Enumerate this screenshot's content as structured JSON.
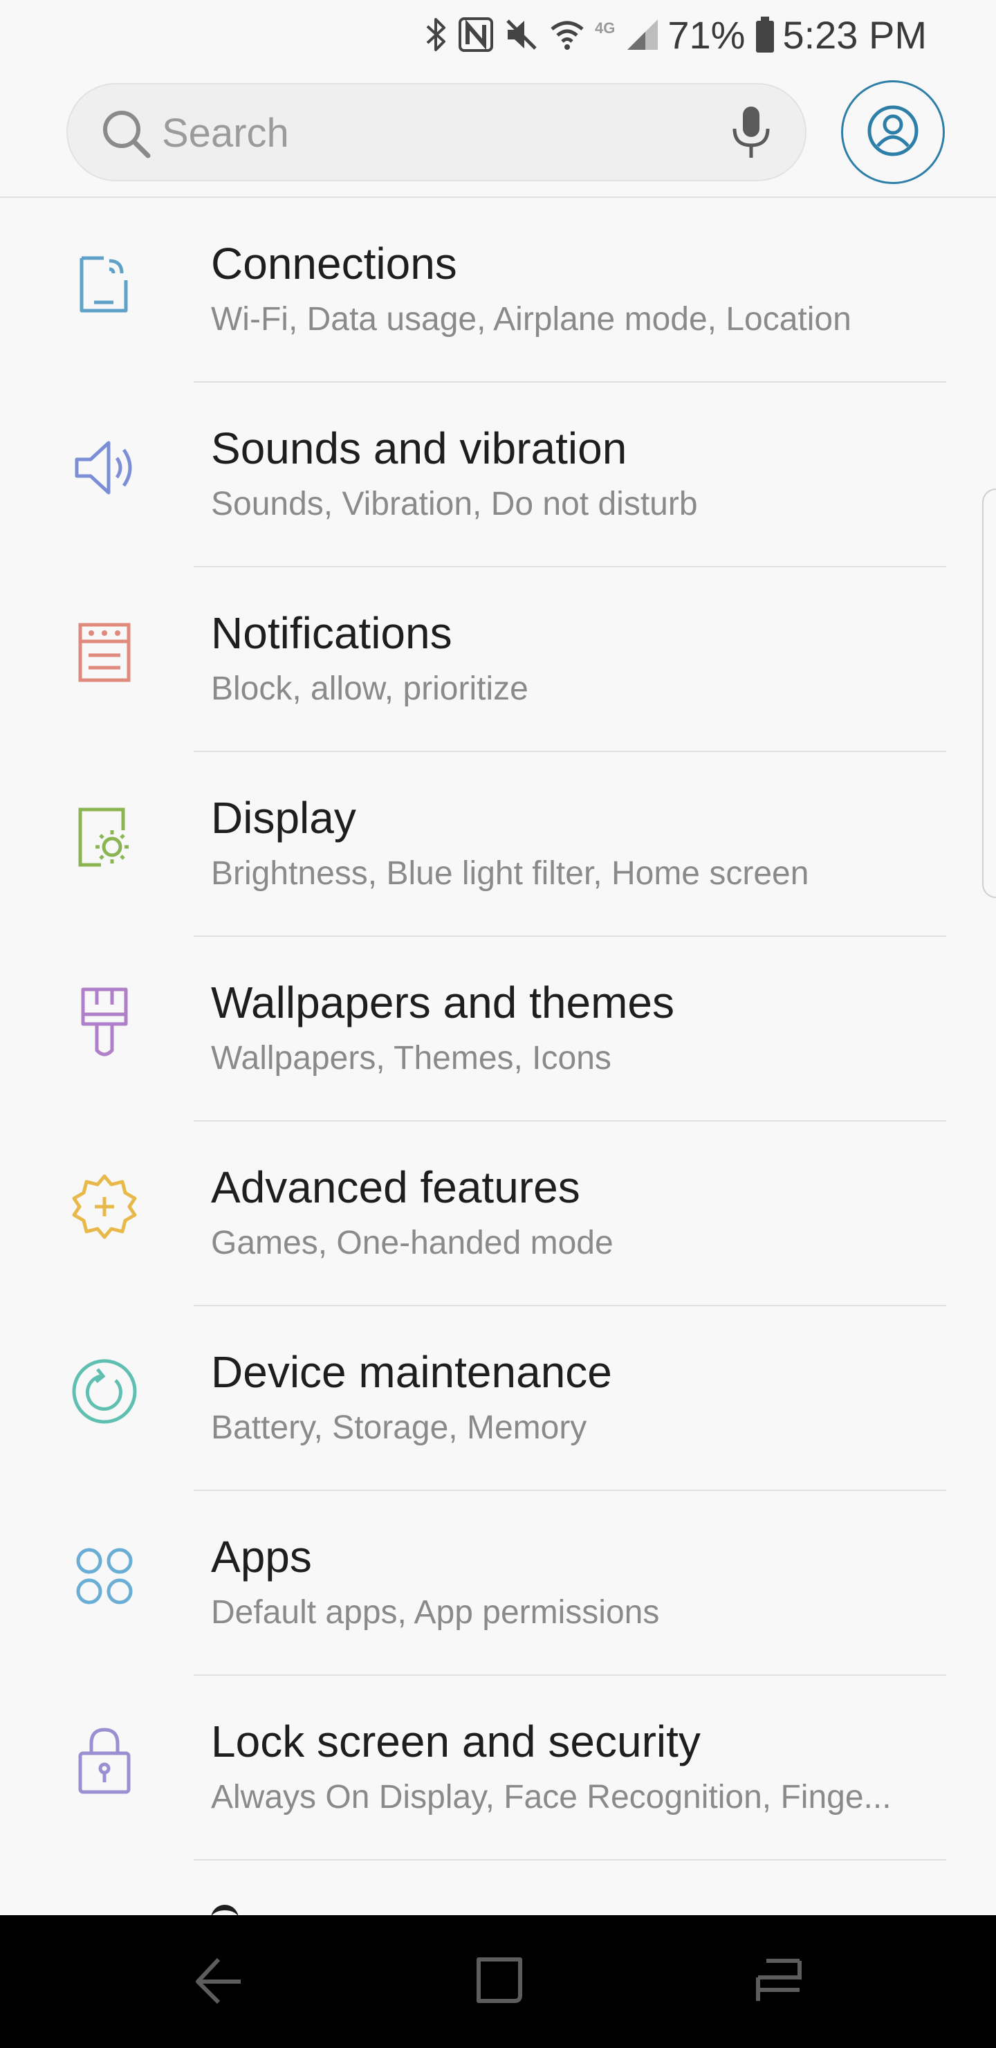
{
  "status_bar": {
    "battery_percent": "71%",
    "time": "5:23 PM",
    "network_label": "4G",
    "icons": [
      "bluetooth-icon",
      "nfc-icon",
      "mute-icon",
      "wifi-icon",
      "signal-icon",
      "battery-icon"
    ]
  },
  "search": {
    "placeholder": "Search"
  },
  "colors": {
    "connections": "#5fa2c9",
    "sounds": "#7b8fd6",
    "notifications": "#e08a7e",
    "display": "#8bb453",
    "wallpapers": "#b07fc9",
    "advanced": "#e6b94a",
    "maintenance": "#5fbfb0",
    "apps": "#6aaed6",
    "lock": "#9a8fd0",
    "account": "#2e7fa8"
  },
  "settings": {
    "items": [
      {
        "title": "Connections",
        "subtitle": "Wi-Fi, Data usage, Airplane mode, Location",
        "icon": "connections-icon"
      },
      {
        "title": "Sounds and vibration",
        "subtitle": "Sounds, Vibration, Do not disturb",
        "icon": "speaker-icon"
      },
      {
        "title": "Notifications",
        "subtitle": "Block, allow, prioritize",
        "icon": "notifications-icon"
      },
      {
        "title": "Display",
        "subtitle": "Brightness, Blue light filter, Home screen",
        "icon": "display-icon"
      },
      {
        "title": "Wallpapers and themes",
        "subtitle": "Wallpapers, Themes, Icons",
        "icon": "paintbrush-icon"
      },
      {
        "title": "Advanced features",
        "subtitle": "Games, One-handed mode",
        "icon": "gear-plus-icon"
      },
      {
        "title": "Device maintenance",
        "subtitle": "Battery, Storage, Memory",
        "icon": "refresh-icon"
      },
      {
        "title": "Apps",
        "subtitle": "Default apps, App permissions",
        "icon": "apps-icon"
      },
      {
        "title": "Lock screen and security",
        "subtitle": "Always On Display, Face Recognition, Finge...",
        "icon": "lock-icon"
      }
    ]
  },
  "nav": {
    "back": "back-icon",
    "home": "home-icon",
    "recents": "recents-icon"
  }
}
